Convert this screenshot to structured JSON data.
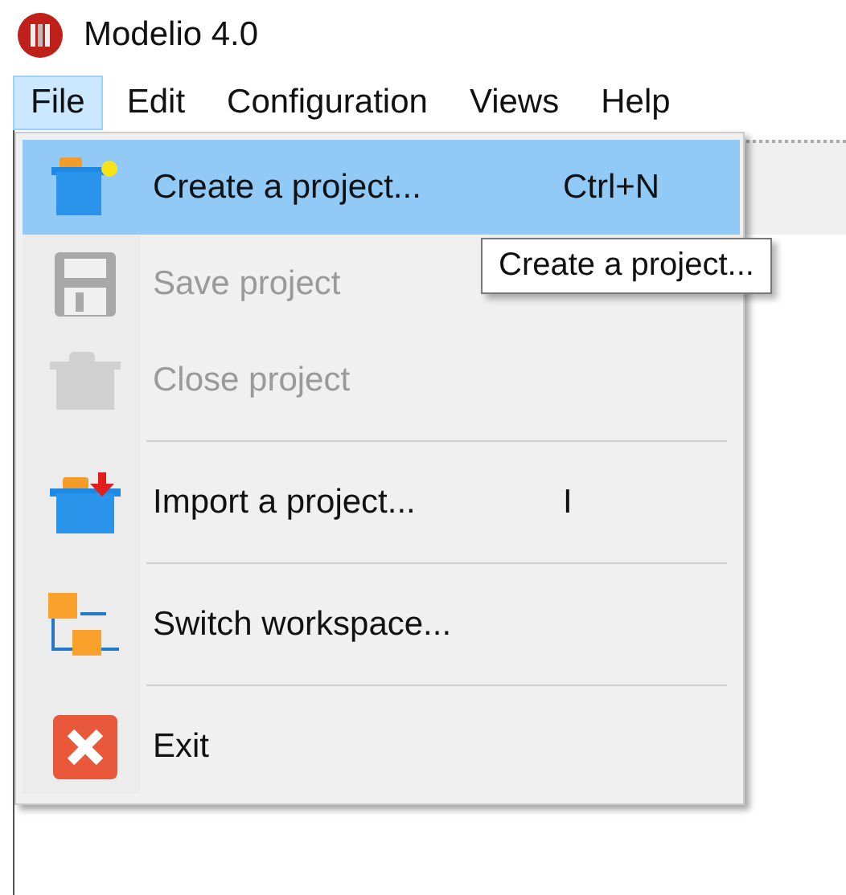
{
  "window": {
    "title": "Modelio 4.0"
  },
  "menubar": [
    {
      "label": "File",
      "selected": true
    },
    {
      "label": "Edit",
      "selected": false
    },
    {
      "label": "Configuration",
      "selected": false
    },
    {
      "label": "Views",
      "selected": false
    },
    {
      "label": "Help",
      "selected": false
    }
  ],
  "file_menu": [
    {
      "kind": "create",
      "label": "Create a project...",
      "shortcut": "Ctrl+N",
      "selected": true,
      "disabled": false
    },
    {
      "kind": "save",
      "label": "Save project",
      "selected": false,
      "disabled": true
    },
    {
      "kind": "close",
      "label": "Close project",
      "selected": false,
      "disabled": true
    },
    {
      "kind": "separator"
    },
    {
      "kind": "import",
      "label": "Import a project...",
      "shortcut": "I",
      "selected": false,
      "disabled": false
    },
    {
      "kind": "separator"
    },
    {
      "kind": "switch",
      "label": "Switch workspace...",
      "selected": false,
      "disabled": false
    },
    {
      "kind": "separator"
    },
    {
      "kind": "exit",
      "label": "Exit",
      "selected": false,
      "disabled": false
    }
  ],
  "tooltip": "Create a project..."
}
